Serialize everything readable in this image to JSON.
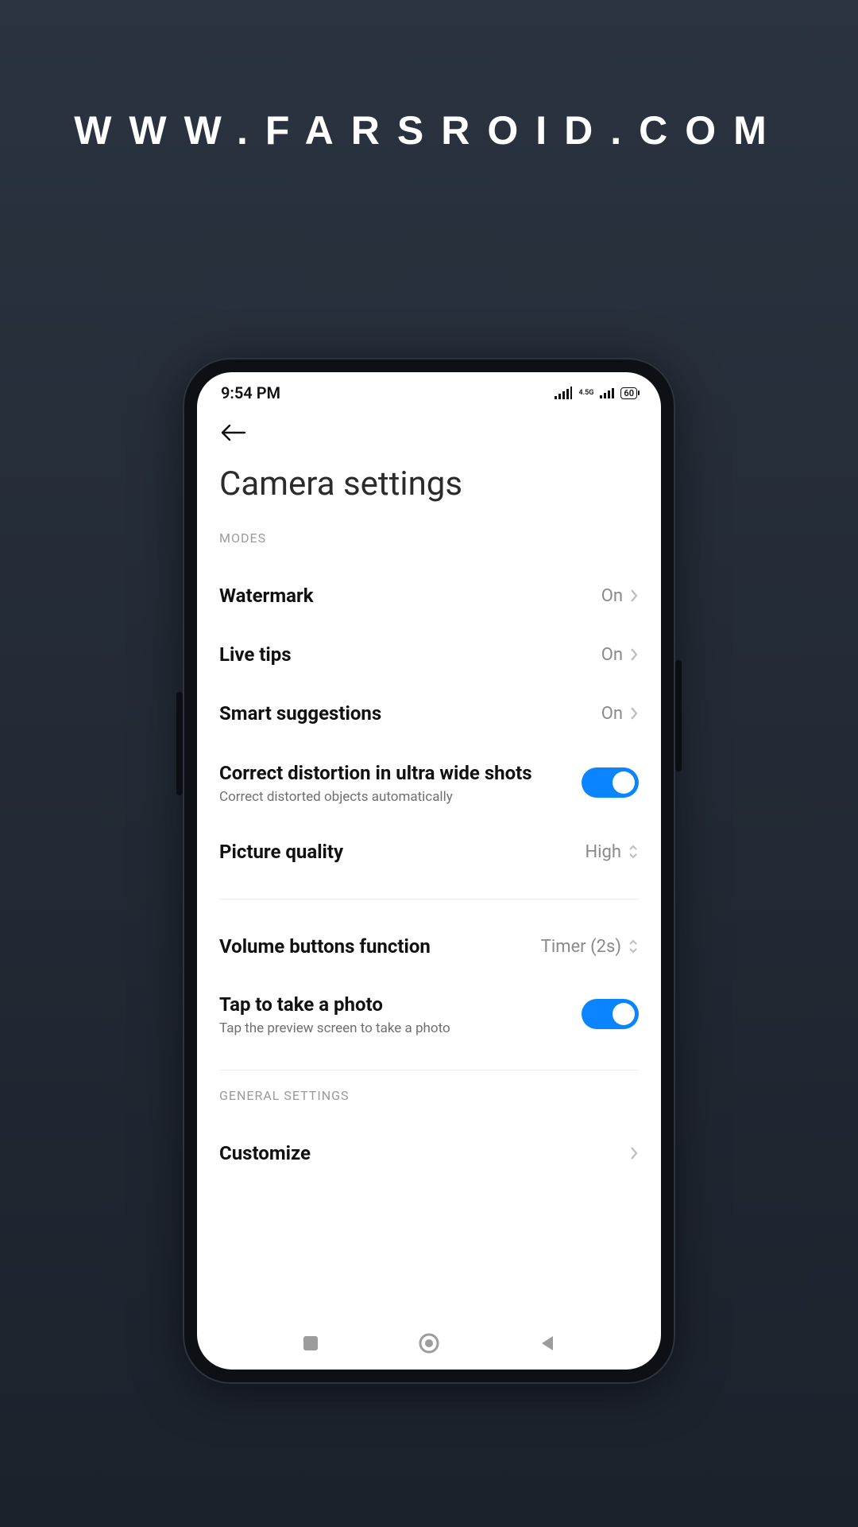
{
  "watermark": "WWW.FARSROID.COM",
  "status": {
    "time": "9:54 PM",
    "network_label": "4.5G",
    "battery": "60"
  },
  "header": {
    "title": "Camera settings"
  },
  "sections": {
    "modes": {
      "label": "MODES",
      "watermark": {
        "title": "Watermark",
        "value": "On"
      },
      "live_tips": {
        "title": "Live tips",
        "value": "On"
      },
      "smart_suggestions": {
        "title": "Smart suggestions",
        "value": "On"
      },
      "distortion": {
        "title": "Correct distortion in ultra wide shots",
        "sub": "Correct distorted objects automatically"
      },
      "picture_quality": {
        "title": "Picture quality",
        "value": "High"
      }
    },
    "controls": {
      "volume": {
        "title": "Volume buttons function",
        "value": "Timer (2s)"
      },
      "tap_photo": {
        "title": "Tap to take a photo",
        "sub": "Tap the preview screen to take a photo"
      }
    },
    "general": {
      "label": "GENERAL SETTINGS",
      "customize": {
        "title": "Customize"
      }
    }
  }
}
